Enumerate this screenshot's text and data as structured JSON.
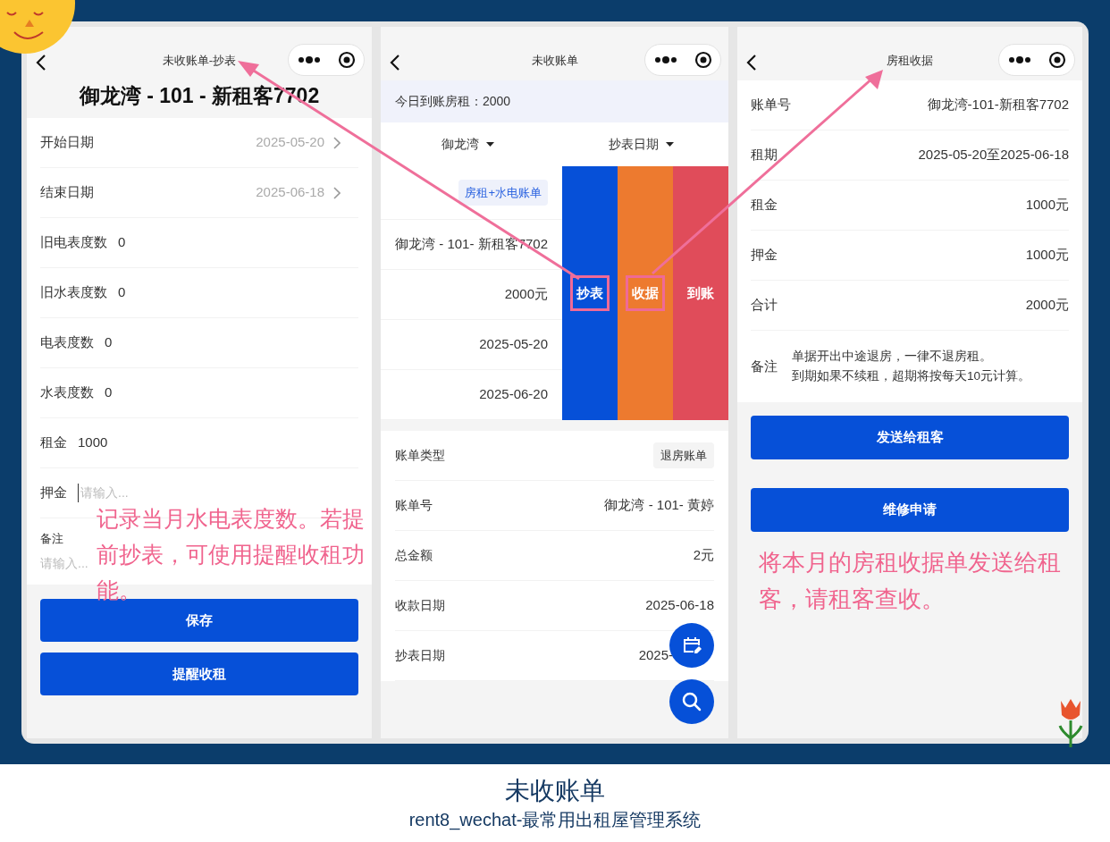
{
  "meter_screen": {
    "nav_title": "未收账单-抄表",
    "heading": "御龙湾 - 101 - 新租客7702",
    "fields": [
      {
        "kind": "picker",
        "label": "开始日期",
        "value": "2025-05-20"
      },
      {
        "kind": "picker",
        "label": "结束日期",
        "value": "2025-06-18"
      },
      {
        "kind": "value",
        "label": "旧电表度数",
        "value": "0"
      },
      {
        "kind": "value",
        "label": "旧水表度数",
        "value": "0"
      },
      {
        "kind": "value",
        "label": "电表度数",
        "value": "0"
      },
      {
        "kind": "value",
        "label": "水表度数",
        "value": "0"
      },
      {
        "kind": "value",
        "label": "租金",
        "value": "1000"
      },
      {
        "kind": "input",
        "label": "押金",
        "placeholder": "请输入..."
      },
      {
        "kind": "textarea",
        "label": "备注",
        "placeholder": "请输入..."
      }
    ],
    "buttons": [
      "保存",
      "提醒收租"
    ],
    "callout": "记录当月水电表度数。若提前抄表，可使用提醒收租功能。"
  },
  "bills_screen": {
    "nav_title": "未收账单",
    "summary": "今日到账房租：2000",
    "filters": [
      "御龙湾",
      "抄表日期"
    ],
    "bill_card": {
      "tag": "房租+水电账单",
      "lines": [
        "御龙湾 - 101- 新租客7702",
        "2000元",
        "2025-05-20",
        "2025-06-20"
      ],
      "actions": [
        {
          "label": "抄表",
          "color": "#0650d8",
          "highlighted": true
        },
        {
          "label": "收据",
          "color": "#ed7a2f",
          "highlighted": true
        },
        {
          "label": "到账",
          "color": "#e04c5a",
          "highlighted": false
        }
      ]
    },
    "detail": [
      {
        "kind": "tag",
        "label": "账单类型",
        "value": "退房账单"
      },
      {
        "kind": "text",
        "label": "账单号",
        "value": "御龙湾 - 101- 黄婷"
      },
      {
        "kind": "text",
        "label": "总金额",
        "value": "2元"
      },
      {
        "kind": "text",
        "label": "收款日期",
        "value": "2025-06-18"
      },
      {
        "kind": "text",
        "label": "抄表日期",
        "value": "2025-"
      }
    ]
  },
  "receipt_screen": {
    "nav_title": "房租收据",
    "rows": [
      {
        "label": "账单号",
        "value": "御龙湾-101-新租客7702"
      },
      {
        "label": "租期",
        "value": "2025-05-20至2025-06-18"
      },
      {
        "label": "租金",
        "value": "1000元"
      },
      {
        "label": "押金",
        "value": "1000元"
      },
      {
        "label": "合计",
        "value": "2000元"
      }
    ],
    "remark": {
      "label": "备注",
      "lines": [
        "单据开出中途退房，一律不退房租。",
        "到期如果不续租，超期将按每天10元计算。"
      ]
    },
    "buttons": [
      "发送给租客",
      "维修申请"
    ],
    "callout": "将本月的房租收据单发送给租客，请租客查收。"
  },
  "caption": {
    "title": "未收账单",
    "subtitle": "rent8_wechat-最常用出租屋管理系统"
  }
}
